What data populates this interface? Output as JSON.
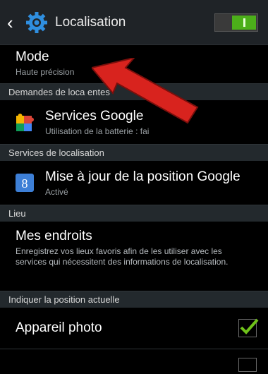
{
  "header": {
    "title": "Localisation",
    "toggle_on": true
  },
  "mode": {
    "title": "Mode",
    "subtitle": "Haute précision"
  },
  "sections": {
    "recent_requests": "Demandes de loca   entes",
    "location_services": "Services de localisation",
    "place": "Lieu",
    "show_position": "Indiquer la position actuelle"
  },
  "google_services": {
    "title": "Services Google",
    "subtitle": "Utilisation de la batterie : fai"
  },
  "google_position": {
    "title": "Mise à jour de la position Google",
    "subtitle": "Activé"
  },
  "my_places": {
    "title": "Mes endroits",
    "description": "Enregistrez vos lieux favoris afin de les utiliser avec les services qui nécessitent des informations de localisation."
  },
  "camera": {
    "title": "Appareil photo",
    "checked": true
  },
  "colors": {
    "toggle_on": "#4caf1a",
    "arrow": "#d8231e",
    "check": "#6fc21a"
  },
  "icons": {
    "back": "chevron-left-icon",
    "settings": "gear-icon",
    "google_services": "puzzle-icon",
    "google_position": "google-g-icon"
  }
}
